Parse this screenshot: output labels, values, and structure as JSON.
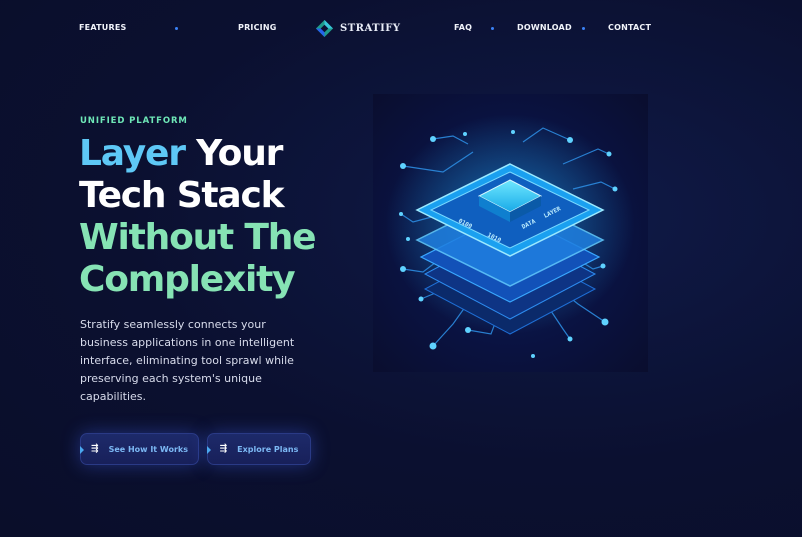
{
  "nav": {
    "links": [
      "FEATURES",
      "PRICING",
      "FAQ",
      "DOWNLOAD",
      "CONTACT"
    ],
    "brand": "STRATIFY",
    "brand_logo_icon": "diamond-logo-icon"
  },
  "hero": {
    "eyebrow": "UNIFIED PLATFORM",
    "headline": {
      "line1_blue": "Layer",
      "line1_white": " Your",
      "line2": "Tech Stack",
      "line3": "Without The",
      "line4": "Complexity"
    },
    "description": "Stratify seamlessly connects your business applications in one intelligent interface, eliminating tool sprawl while preserving each system's unique capabilities.",
    "buttons": [
      {
        "label": "See How It Works",
        "icon": "arrow-lines-icon"
      },
      {
        "label": "Explore Plans",
        "icon": "arrow-lines-icon"
      }
    ]
  },
  "illustration": {
    "chip_labels": [
      "0100",
      "1010",
      "DATA",
      "LAYER"
    ]
  },
  "colors": {
    "background": "#0b1030",
    "accent_blue": "#5ec8f6",
    "accent_green": "#86e3b4",
    "eyebrow_green": "#6ee7b7",
    "button_text": "#7cb8f4"
  }
}
